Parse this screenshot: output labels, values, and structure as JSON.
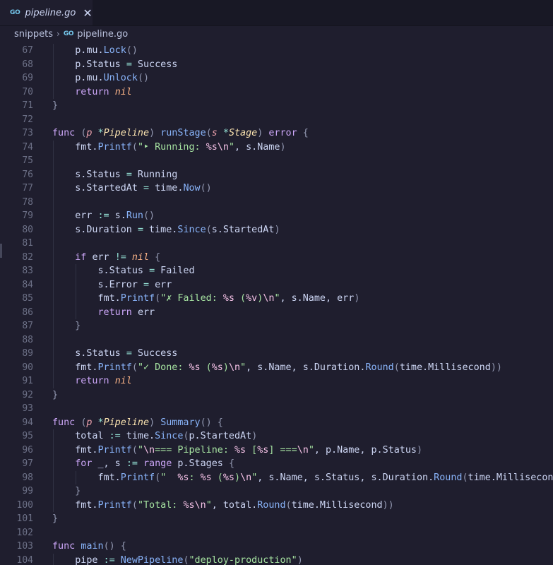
{
  "tab": {
    "title": "pipeline.go",
    "icon": "go-file-icon",
    "close_glyph": "✕",
    "icon_text": "GO"
  },
  "breadcrumb": {
    "folder": "snippets",
    "separator": "›",
    "file": "pipeline.go"
  },
  "colors": {
    "background": "#1f1e2e",
    "keyword": "#cba6f7",
    "function": "#89b4fa",
    "type": "#f9e2af",
    "string": "#a6e3a1",
    "line_number": "#6c7086"
  },
  "lines": [
    {
      "n": "67",
      "tokens": [
        [
          "pl",
          "        p.mu."
        ],
        [
          "fn",
          "Lock"
        ],
        [
          "br",
          "()"
        ]
      ]
    },
    {
      "n": "68",
      "tokens": [
        [
          "pl",
          "        p.Status "
        ],
        [
          "op",
          "="
        ],
        [
          "pl",
          " Success"
        ]
      ]
    },
    {
      "n": "69",
      "tokens": [
        [
          "pl",
          "        p.mu."
        ],
        [
          "fn",
          "Unlock"
        ],
        [
          "br",
          "()"
        ]
      ]
    },
    {
      "n": "70",
      "tokens": [
        [
          "kw",
          "        return "
        ],
        [
          "nil",
          "nil"
        ]
      ]
    },
    {
      "n": "71",
      "tokens": [
        [
          "br",
          "    }"
        ]
      ]
    },
    {
      "n": "72",
      "tokens": []
    },
    {
      "n": "73",
      "tokens": [
        [
          "kw",
          "    func "
        ],
        [
          "br",
          "("
        ],
        [
          "pm",
          "p "
        ],
        [
          "op",
          "*"
        ],
        [
          "ty",
          "Pipeline"
        ],
        [
          "br",
          ") "
        ],
        [
          "fn",
          "runStage"
        ],
        [
          "br",
          "("
        ],
        [
          "pm",
          "s "
        ],
        [
          "op",
          "*"
        ],
        [
          "ty",
          "Stage"
        ],
        [
          "br",
          ") "
        ],
        [
          "kw",
          "error"
        ],
        [
          "br",
          " {"
        ]
      ]
    },
    {
      "n": "74",
      "tokens": [
        [
          "pl",
          "        fmt."
        ],
        [
          "fn",
          "Printf"
        ],
        [
          "br",
          "("
        ],
        [
          "str",
          "\"‣ Running: "
        ],
        [
          "fmt",
          "%s\\n"
        ],
        [
          "str",
          "\""
        ],
        [
          "pl",
          ", s.Name"
        ],
        [
          "br",
          ")"
        ]
      ]
    },
    {
      "n": "75",
      "tokens": []
    },
    {
      "n": "76",
      "tokens": [
        [
          "pl",
          "        s.Status "
        ],
        [
          "op",
          "="
        ],
        [
          "pl",
          " Running"
        ]
      ]
    },
    {
      "n": "77",
      "tokens": [
        [
          "pl",
          "        s.StartedAt "
        ],
        [
          "op",
          "="
        ],
        [
          "pl",
          " time."
        ],
        [
          "fn",
          "Now"
        ],
        [
          "br",
          "()"
        ]
      ]
    },
    {
      "n": "78",
      "tokens": []
    },
    {
      "n": "79",
      "tokens": [
        [
          "pl",
          "        err "
        ],
        [
          "op",
          ":="
        ],
        [
          "pl",
          " s."
        ],
        [
          "fn",
          "Run"
        ],
        [
          "br",
          "()"
        ]
      ]
    },
    {
      "n": "80",
      "tokens": [
        [
          "pl",
          "        s.Duration "
        ],
        [
          "op",
          "="
        ],
        [
          "pl",
          " time."
        ],
        [
          "fn",
          "Since"
        ],
        [
          "br",
          "("
        ],
        [
          "pl",
          "s.StartedAt"
        ],
        [
          "br",
          ")"
        ]
      ]
    },
    {
      "n": "81",
      "tokens": []
    },
    {
      "n": "82",
      "tokens": [
        [
          "kw",
          "        if "
        ],
        [
          "pl",
          "err "
        ],
        [
          "op",
          "!="
        ],
        [
          "pl",
          " "
        ],
        [
          "nil",
          "nil"
        ],
        [
          "br",
          " {"
        ]
      ]
    },
    {
      "n": "83",
      "tokens": [
        [
          "pl",
          "            s.Status "
        ],
        [
          "op",
          "="
        ],
        [
          "pl",
          " Failed"
        ]
      ]
    },
    {
      "n": "84",
      "tokens": [
        [
          "pl",
          "            s.Error "
        ],
        [
          "op",
          "="
        ],
        [
          "pl",
          " err"
        ]
      ]
    },
    {
      "n": "85",
      "tokens": [
        [
          "pl",
          "            fmt."
        ],
        [
          "fn",
          "Printf"
        ],
        [
          "br",
          "("
        ],
        [
          "str",
          "\"✗ Failed: "
        ],
        [
          "fmt",
          "%s"
        ],
        [
          "str",
          " ("
        ],
        [
          "fmt",
          "%v"
        ],
        [
          "str",
          ")"
        ],
        [
          "fmt",
          "\\n"
        ],
        [
          "str",
          "\""
        ],
        [
          "pl",
          ", s.Name, err"
        ],
        [
          "br",
          ")"
        ]
      ]
    },
    {
      "n": "86",
      "tokens": [
        [
          "kw",
          "            return "
        ],
        [
          "pl",
          "err"
        ]
      ]
    },
    {
      "n": "87",
      "tokens": [
        [
          "br",
          "        }"
        ]
      ]
    },
    {
      "n": "88",
      "tokens": []
    },
    {
      "n": "89",
      "tokens": [
        [
          "pl",
          "        s.Status "
        ],
        [
          "op",
          "="
        ],
        [
          "pl",
          " Success"
        ]
      ]
    },
    {
      "n": "90",
      "tokens": [
        [
          "pl",
          "        fmt."
        ],
        [
          "fn",
          "Printf"
        ],
        [
          "br",
          "("
        ],
        [
          "str",
          "\"✓ Done: "
        ],
        [
          "fmt",
          "%s"
        ],
        [
          "str",
          " ("
        ],
        [
          "fmt",
          "%s"
        ],
        [
          "str",
          ")"
        ],
        [
          "fmt",
          "\\n"
        ],
        [
          "str",
          "\""
        ],
        [
          "pl",
          ", s.Name, s.Duration."
        ],
        [
          "fn",
          "Round"
        ],
        [
          "br",
          "("
        ],
        [
          "pl",
          "time.Millisecond"
        ],
        [
          "br",
          "))"
        ]
      ]
    },
    {
      "n": "91",
      "tokens": [
        [
          "kw",
          "        return "
        ],
        [
          "nil",
          "nil"
        ]
      ]
    },
    {
      "n": "92",
      "tokens": [
        [
          "br",
          "    }"
        ]
      ]
    },
    {
      "n": "93",
      "tokens": []
    },
    {
      "n": "94",
      "tokens": [
        [
          "kw",
          "    func "
        ],
        [
          "br",
          "("
        ],
        [
          "pm",
          "p "
        ],
        [
          "op",
          "*"
        ],
        [
          "ty",
          "Pipeline"
        ],
        [
          "br",
          ") "
        ],
        [
          "fn",
          "Summary"
        ],
        [
          "br",
          "() {"
        ]
      ]
    },
    {
      "n": "95",
      "tokens": [
        [
          "pl",
          "        total "
        ],
        [
          "op",
          ":="
        ],
        [
          "pl",
          " time."
        ],
        [
          "fn",
          "Since"
        ],
        [
          "br",
          "("
        ],
        [
          "pl",
          "p.StartedAt"
        ],
        [
          "br",
          ")"
        ]
      ]
    },
    {
      "n": "96",
      "tokens": [
        [
          "pl",
          "        fmt."
        ],
        [
          "fn",
          "Printf"
        ],
        [
          "br",
          "("
        ],
        [
          "str",
          "\""
        ],
        [
          "fmt",
          "\\n"
        ],
        [
          "str",
          "=== Pipeline: "
        ],
        [
          "fmt",
          "%s"
        ],
        [
          "str",
          " ["
        ],
        [
          "fmt",
          "%s"
        ],
        [
          "str",
          "] ==="
        ],
        [
          "fmt",
          "\\n"
        ],
        [
          "str",
          "\""
        ],
        [
          "pl",
          ", p.Name, p.Status"
        ],
        [
          "br",
          ")"
        ]
      ]
    },
    {
      "n": "97",
      "tokens": [
        [
          "kw",
          "        for "
        ],
        [
          "pl",
          "_, s "
        ],
        [
          "op",
          ":="
        ],
        [
          "kw",
          " range "
        ],
        [
          "pl",
          "p.Stages "
        ],
        [
          "br",
          "{"
        ]
      ]
    },
    {
      "n": "98",
      "tokens": [
        [
          "pl",
          "            fmt."
        ],
        [
          "fn",
          "Printf"
        ],
        [
          "br",
          "("
        ],
        [
          "str",
          "\"  "
        ],
        [
          "fmt",
          "%s"
        ],
        [
          "str",
          ": "
        ],
        [
          "fmt",
          "%s"
        ],
        [
          "str",
          " ("
        ],
        [
          "fmt",
          "%s"
        ],
        [
          "str",
          ")"
        ],
        [
          "fmt",
          "\\n"
        ],
        [
          "str",
          "\""
        ],
        [
          "pl",
          ", s.Name, s.Status, s.Duration."
        ],
        [
          "fn",
          "Round"
        ],
        [
          "br",
          "("
        ],
        [
          "pl",
          "time.Millisecond"
        ],
        [
          "br",
          ")"
        ]
      ]
    },
    {
      "n": "99",
      "tokens": [
        [
          "br",
          "        }"
        ]
      ]
    },
    {
      "n": "100",
      "tokens": [
        [
          "pl",
          "        fmt."
        ],
        [
          "fn",
          "Printf"
        ],
        [
          "br",
          "("
        ],
        [
          "str",
          "\"Total: "
        ],
        [
          "fmt",
          "%s\\n"
        ],
        [
          "str",
          "\""
        ],
        [
          "pl",
          ", total."
        ],
        [
          "fn",
          "Round"
        ],
        [
          "br",
          "("
        ],
        [
          "pl",
          "time.Millisecond"
        ],
        [
          "br",
          "))"
        ]
      ]
    },
    {
      "n": "101",
      "tokens": [
        [
          "br",
          "    }"
        ]
      ]
    },
    {
      "n": "102",
      "tokens": []
    },
    {
      "n": "103",
      "tokens": [
        [
          "kw",
          "    func "
        ],
        [
          "fn",
          "main"
        ],
        [
          "br",
          "() {"
        ]
      ]
    },
    {
      "n": "104",
      "tokens": [
        [
          "pl",
          "        pipe "
        ],
        [
          "op",
          ":="
        ],
        [
          "pl",
          " "
        ],
        [
          "fn",
          "NewPipeline"
        ],
        [
          "br",
          "("
        ],
        [
          "str",
          "\"deploy-production\""
        ],
        [
          "br",
          ")"
        ]
      ]
    }
  ]
}
